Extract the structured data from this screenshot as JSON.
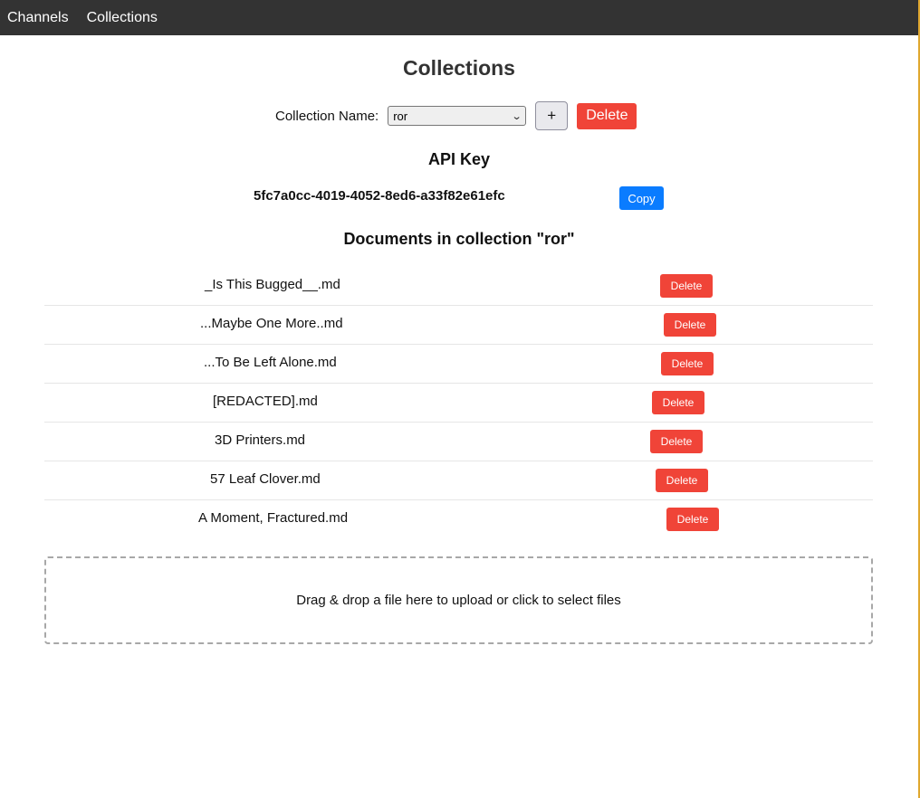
{
  "nav": {
    "items": [
      {
        "label": "Channels"
      },
      {
        "label": "Collections"
      }
    ]
  },
  "page": {
    "title": "Collections"
  },
  "collection": {
    "label": "Collection Name:",
    "selected": "ror",
    "add_label": "+",
    "delete_label": "Delete"
  },
  "api": {
    "heading": "API Key",
    "key": "5fc7a0cc-4019-4052-8ed6-a33f82e61efc",
    "copy_label": "Copy"
  },
  "documents": {
    "heading": "Documents in collection \"ror\"",
    "delete_label": "Delete",
    "items": [
      {
        "name": "_Is This Bugged__.md"
      },
      {
        "name": "...Maybe One More..md"
      },
      {
        "name": "...To Be Left Alone.md"
      },
      {
        "name": "[REDACTED].md"
      },
      {
        "name": "3D Printers.md"
      },
      {
        "name": "57 Leaf Clover.md"
      },
      {
        "name": "A Moment, Fractured.md"
      }
    ]
  },
  "upload": {
    "prompt": "Drag & drop a file here to upload or click to select files"
  },
  "colors": {
    "navbar": "#333333",
    "danger": "#f04438",
    "primary": "#0a7cff"
  }
}
